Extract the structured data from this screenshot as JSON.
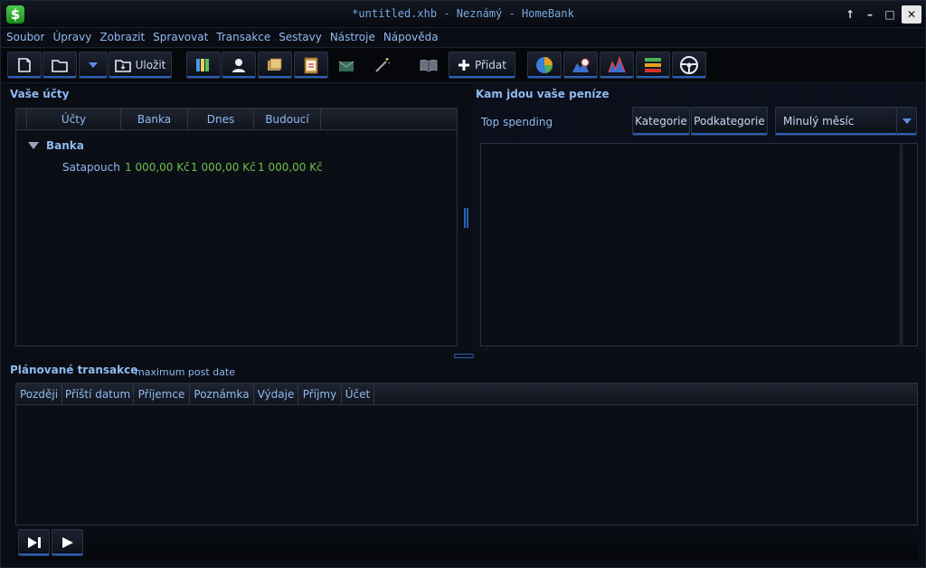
{
  "window": {
    "title": "*untitled.xhb - Neznámý - HomeBank",
    "app_icon": "$"
  },
  "menu": [
    "Soubor",
    "Úpravy",
    "Zobrazit",
    "Spravovat",
    "Transakce",
    "Sestavy",
    "Nástroje",
    "Nápověda"
  ],
  "toolbar": {
    "save_label": "Uložit",
    "add_label": "Přidat"
  },
  "accounts": {
    "title": "Vaše účty",
    "columns": [
      "Účty",
      "Banka",
      "Dnes",
      "Budoucí"
    ],
    "group": "Banka",
    "rows": [
      {
        "name": "Satapouch",
        "bank": "1 000,00 Kč",
        "today": "1 000,00 Kč",
        "future": "1 000,00 Kč"
      }
    ]
  },
  "spending": {
    "title": "Kam jdou vaše peníze",
    "subtitle": "Top spending",
    "btn_category": "Kategorie",
    "btn_subcategory": "Podkategorie",
    "range": "Minulý měsíc"
  },
  "scheduled": {
    "title": "Plánované transakce",
    "subtitle": "maximum post date",
    "columns": [
      "Později",
      "Příští datum",
      "Příjemce",
      "Poznámka",
      "Výdaje",
      "Příjmy",
      "Účet"
    ]
  },
  "colors": {
    "accent": "#2a60b8",
    "amount": "#6cc04a",
    "text": "#8fbaf0"
  }
}
